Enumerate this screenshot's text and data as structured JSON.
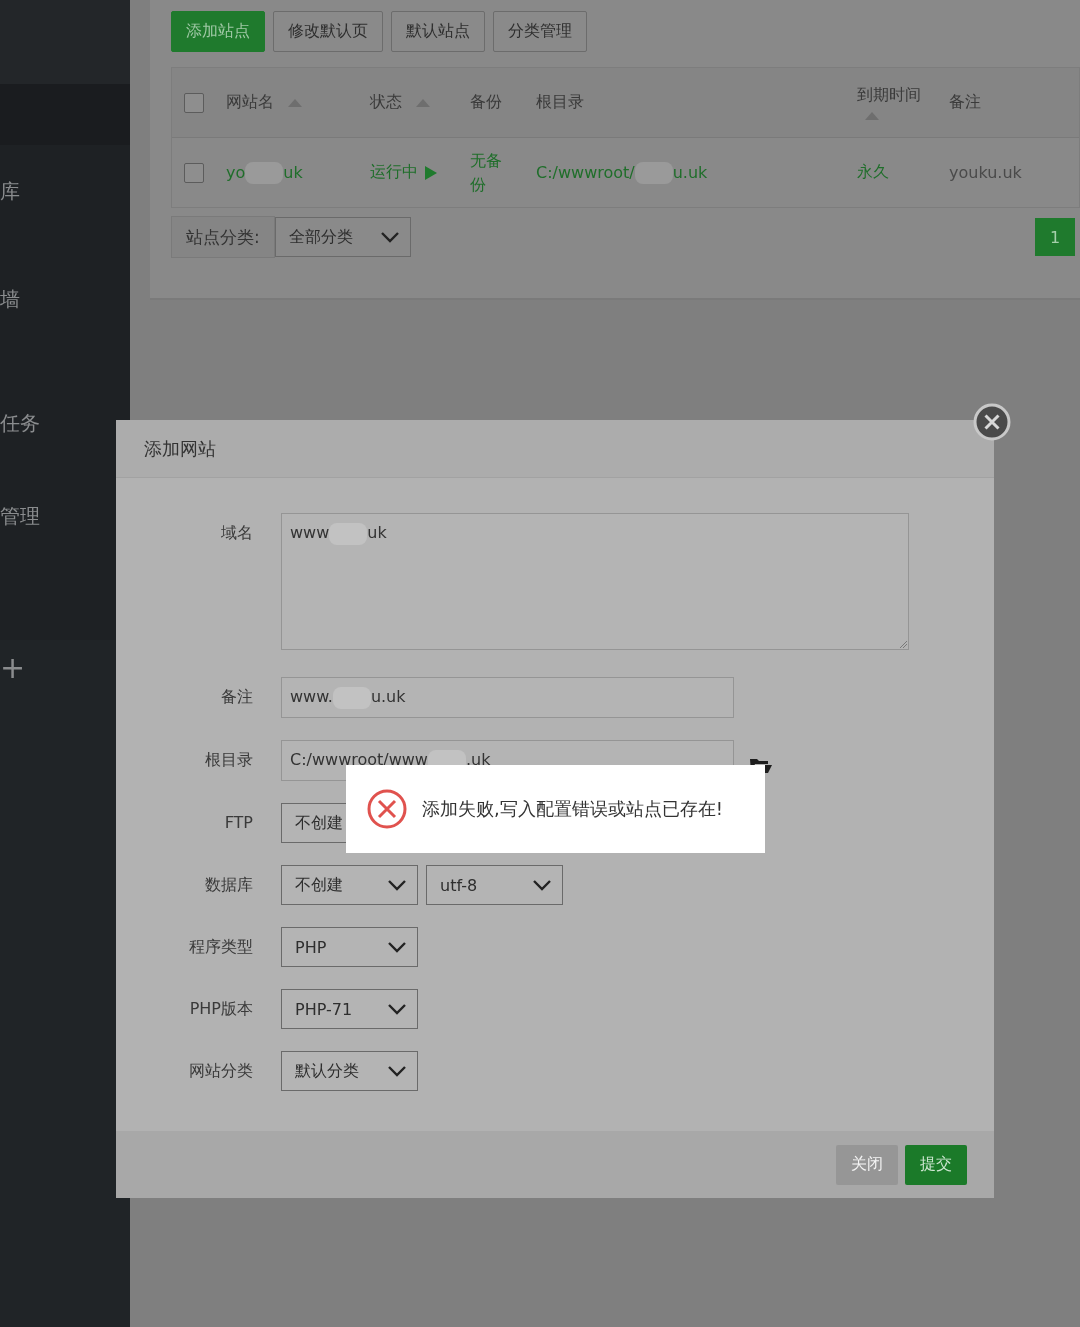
{
  "sidebar": {
    "items": [
      {
        "label": "库"
      },
      {
        "label": "墙"
      },
      {
        "label": "任务"
      },
      {
        "label": "管理"
      },
      {
        "label": "+"
      }
    ]
  },
  "toolbar": {
    "buttons": [
      {
        "label": "添加站点",
        "primary": true
      },
      {
        "label": "修改默认页",
        "primary": false
      },
      {
        "label": "默认站点",
        "primary": false
      },
      {
        "label": "分类管理",
        "primary": false
      }
    ]
  },
  "table": {
    "select_all": {
      "checked": false
    },
    "columns": [
      {
        "label": "网站名",
        "sortable": true
      },
      {
        "label": "状态",
        "sortable": true
      },
      {
        "label": "备份",
        "sortable": false
      },
      {
        "label": "根目录",
        "sortable": false
      },
      {
        "label": "到期时间",
        "sortable": true
      },
      {
        "label": "备注",
        "sortable": false
      }
    ],
    "rows": [
      {
        "checked": false,
        "name": {
          "before": "yo",
          "after": "uk"
        },
        "status": "运行中",
        "backup": "无备份",
        "root": {
          "before": "C:/wwwroot/",
          "after": "u.uk"
        },
        "expiry": "永久",
        "note": "youku.uk"
      }
    ]
  },
  "category_filter": {
    "label": "站点分类:",
    "value": "全部分类"
  },
  "pagination": [
    {
      "label": "1",
      "selected": true
    }
  ],
  "dialog": {
    "title": "添加网站",
    "fields": [
      {
        "label": "域名",
        "kind": "textarea",
        "before": "www",
        "after": "uk"
      },
      {
        "label": "备注",
        "kind": "input",
        "before": "www.",
        "after": "u.uk"
      },
      {
        "label": "根目录",
        "kind": "path",
        "before": "C:/wwwroot/www",
        "after": ".uk"
      },
      {
        "label": "FTP",
        "kind": "select",
        "selects": [
          {
            "value": "不创建"
          }
        ]
      },
      {
        "label": "数据库",
        "kind": "select",
        "selects": [
          {
            "value": "不创建"
          },
          {
            "value": "utf-8"
          }
        ]
      },
      {
        "label": "程序类型",
        "kind": "select",
        "selects": [
          {
            "value": "PHP"
          }
        ]
      },
      {
        "label": "PHP版本",
        "kind": "select",
        "selects": [
          {
            "value": "PHP-71"
          }
        ]
      },
      {
        "label": "网站分类",
        "kind": "select",
        "selects": [
          {
            "value": "默认分类"
          }
        ]
      }
    ],
    "buttons": [
      {
        "label": "关闭",
        "primary": false
      },
      {
        "label": "提交",
        "primary": true
      }
    ]
  },
  "toast": {
    "message": "添加失败,写入配置错误或站点已存在!"
  }
}
